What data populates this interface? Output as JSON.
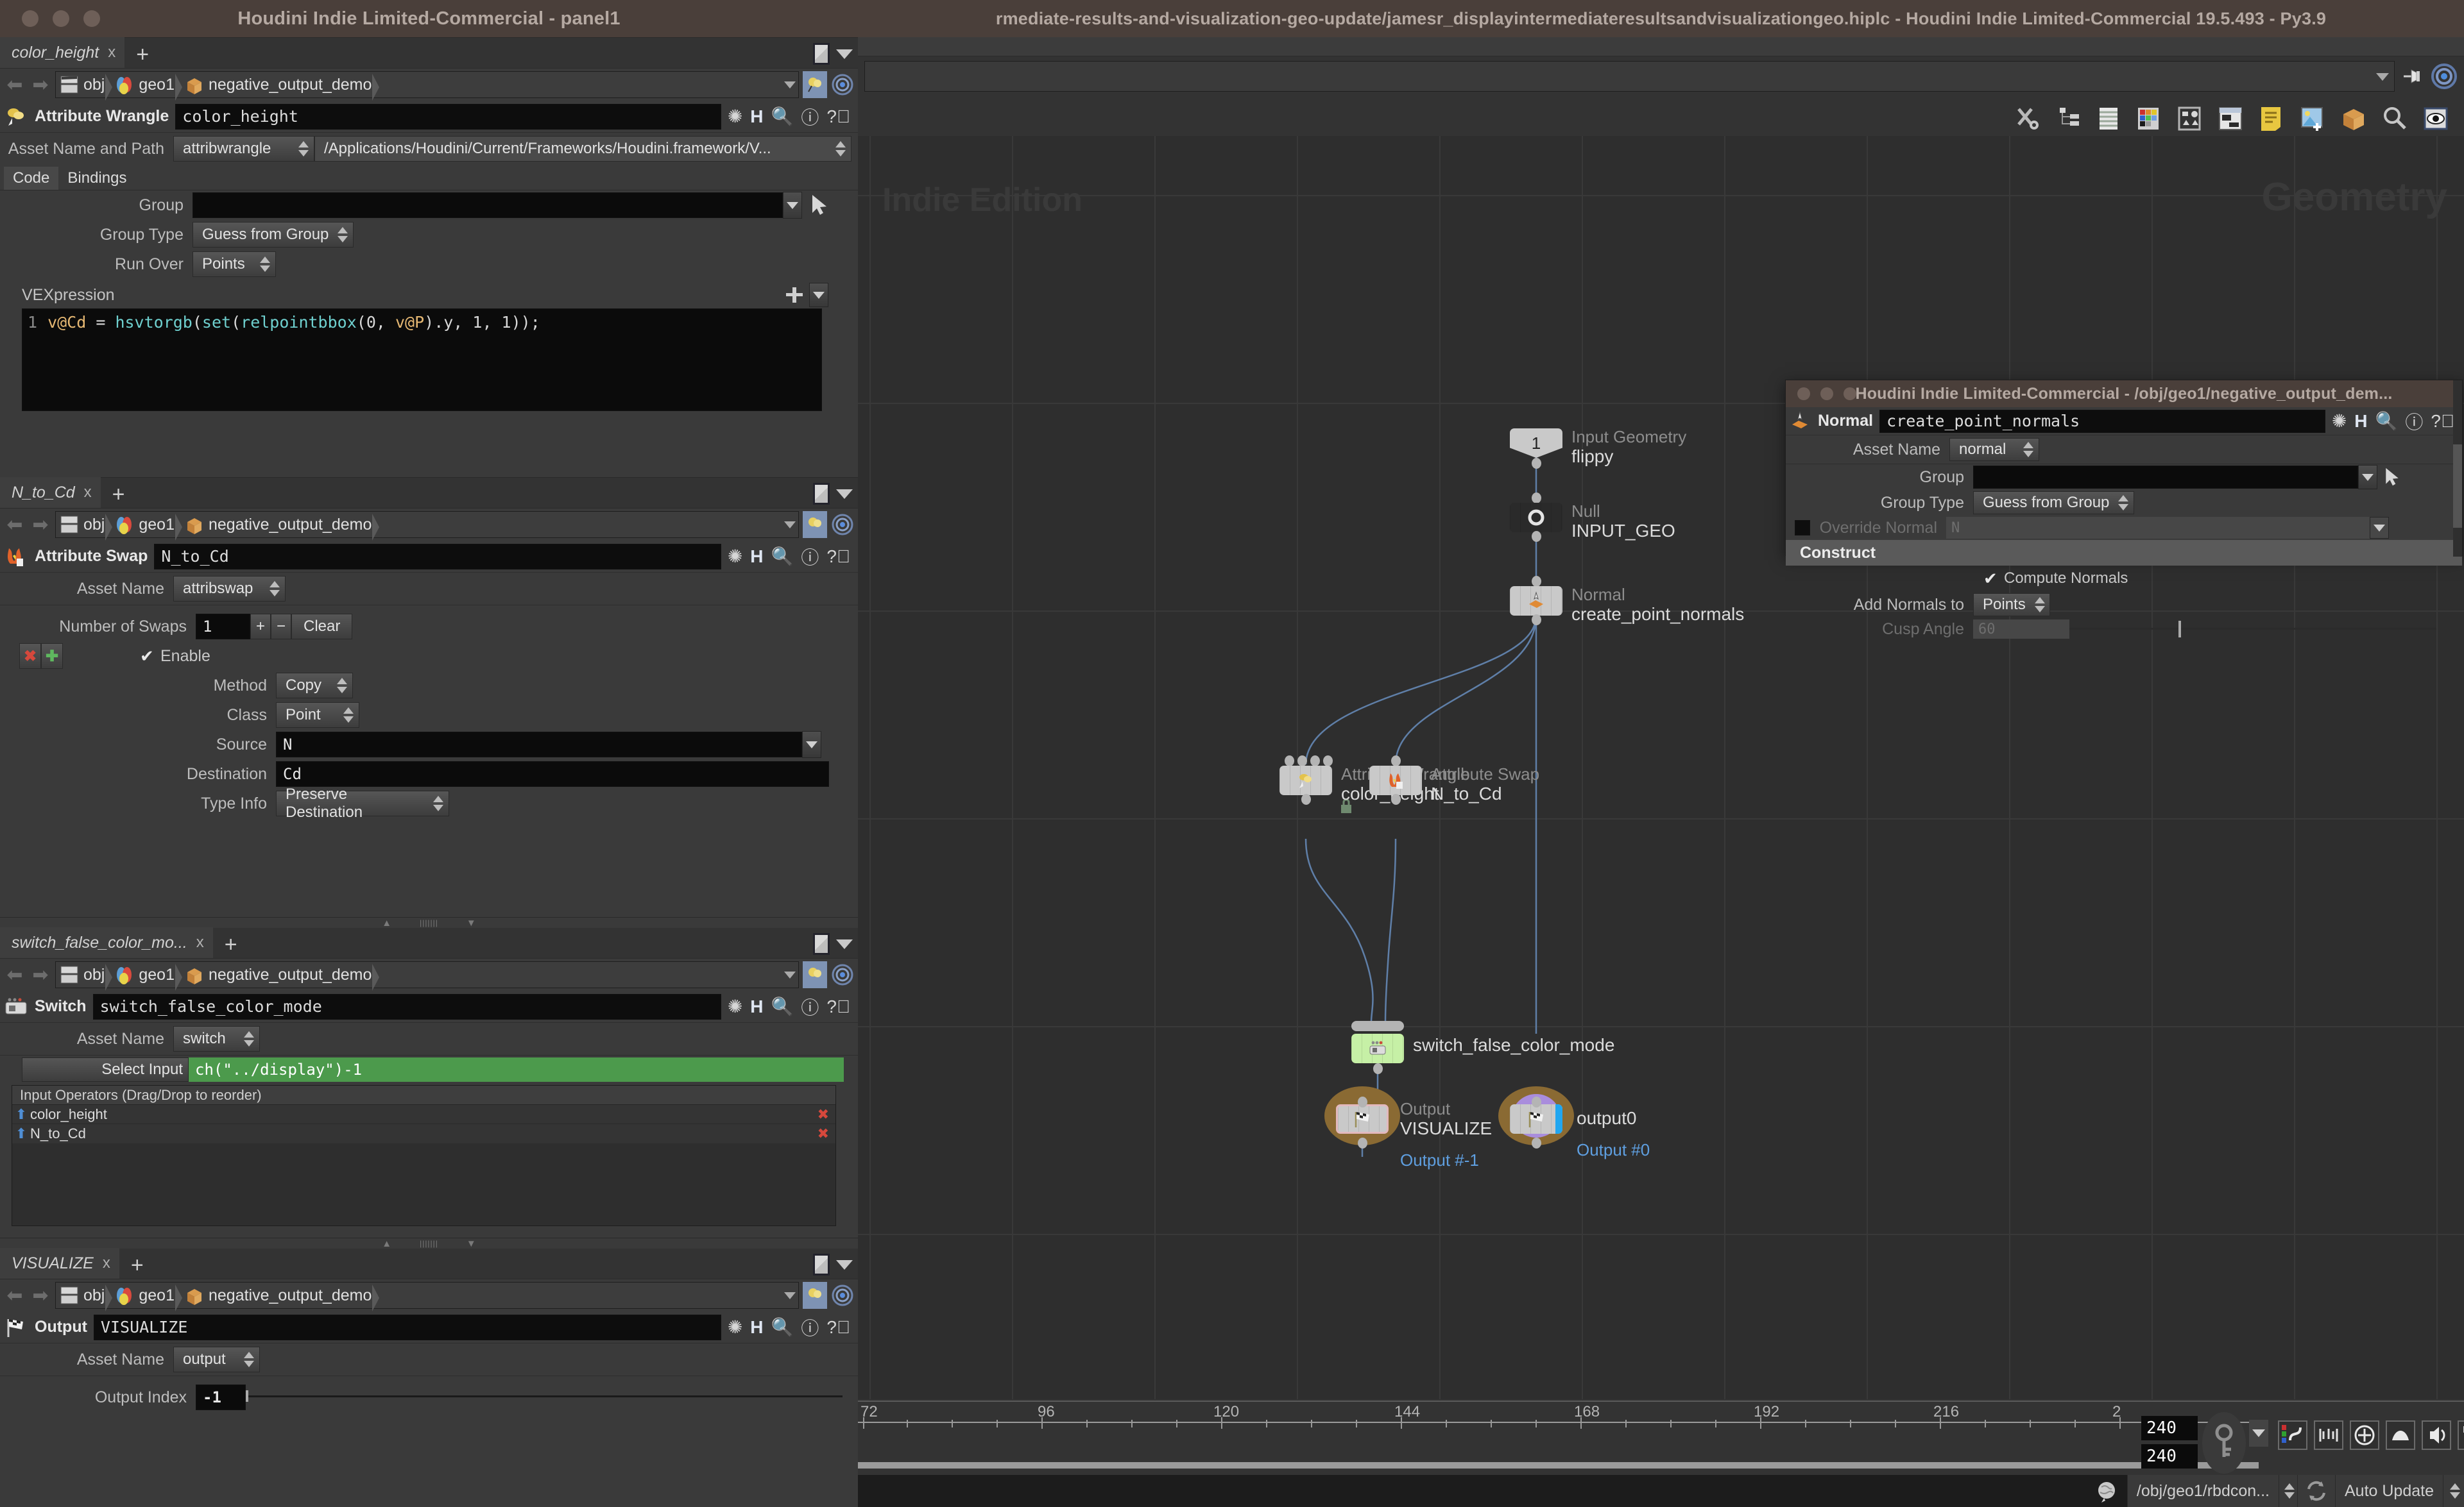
{
  "app": {
    "panel_window_title": "Houdini Indie Limited-Commercial - panel1",
    "main_window_title": "rmediate-results-and-visualization-geo-update/jamesr_displayintermediateresultsandvisualizationgeo.hiplc - Houdini Indie Limited-Commercial 19.5.493 - Py3.9",
    "float_window_title": "Houdini Indie Limited-Commercial - /obj/geo1/negative_output_dem..."
  },
  "breadcrumb": {
    "items": [
      "obj",
      "geo1",
      "negative_output_demo"
    ]
  },
  "panels": [
    {
      "tab_label": "color_height",
      "node_type": "Attribute Wrangle",
      "node_name": "color_height",
      "asset_label": "Asset Name and Path",
      "asset_name": "attribwrangle",
      "asset_path": "/Applications/Houdini/Current/Frameworks/Houdini.framework/V...",
      "subtabs": [
        "Code",
        "Bindings"
      ],
      "subtab_active": "Code",
      "fields": {
        "group_label": "Group",
        "group_value": "",
        "group_type_label": "Group Type",
        "group_type_value": "Guess from Group",
        "run_over_label": "Run Over",
        "run_over_value": "Points",
        "vexpression_label": "VEXpression",
        "code_line_number": "1",
        "code_tokens": [
          {
            "t": "v@Cd",
            "c": "var"
          },
          {
            "t": " = ",
            "c": "op"
          },
          {
            "t": "hsvtorgb",
            "c": "fn"
          },
          {
            "t": "(",
            "c": "op"
          },
          {
            "t": "set",
            "c": "fn"
          },
          {
            "t": "(",
            "c": "op"
          },
          {
            "t": "relpointbbox",
            "c": "fn"
          },
          {
            "t": "(0, ",
            "c": "op"
          },
          {
            "t": "v@P",
            "c": "var"
          },
          {
            "t": ").y, 1, 1));",
            "c": "op"
          }
        ]
      }
    },
    {
      "tab_label": "N_to_Cd",
      "node_type": "Attribute Swap",
      "node_name": "N_to_Cd",
      "asset_label": "Asset Name",
      "asset_name": "attribswap",
      "fields": {
        "num_swaps_label": "Number of Swaps",
        "num_swaps_value": "1",
        "clear_label": "Clear",
        "enable_label": "Enable",
        "enable_checked": true,
        "method_label": "Method",
        "method_value": "Copy",
        "class_label": "Class",
        "class_value": "Point",
        "source_label": "Source",
        "source_value": "N",
        "destination_label": "Destination",
        "destination_value": "Cd",
        "type_info_label": "Type Info",
        "type_info_value": "Preserve Destination"
      }
    },
    {
      "tab_label": "switch_false_color_mo...",
      "node_type": "Switch",
      "node_name": "switch_false_color_mode",
      "asset_label": "Asset Name",
      "asset_name": "switch",
      "fields": {
        "select_input_label": "Select Input",
        "select_input_value": "ch(\"../display\")-1",
        "select_input_color": "#4c9a4c",
        "list_header": "Input Operators (Drag/Drop to reorder)",
        "list_items": [
          "color_height",
          "N_to_Cd"
        ]
      }
    },
    {
      "tab_label": "VISUALIZE",
      "node_type": "Output",
      "node_name": "VISUALIZE",
      "asset_label": "Asset Name",
      "asset_name": "output",
      "fields": {
        "output_index_label": "Output Index",
        "output_index_value": "-1"
      }
    }
  ],
  "network": {
    "watermark_left": "Indie Edition",
    "watermark_right": "Geometry",
    "nodes": [
      {
        "type": "Input Geometry",
        "name": "flippy",
        "badge": "1"
      },
      {
        "type": "Null",
        "name": "INPUT_GEO"
      },
      {
        "type": "Normal",
        "name": "create_point_normals"
      },
      {
        "type": "Attribute Wrangle",
        "name": "color_height"
      },
      {
        "type": "Attribute Swap",
        "name": "N_to_Cd"
      },
      {
        "type": "",
        "name": "switch_false_color_mode"
      },
      {
        "type": "Output",
        "name": "VISUALIZE",
        "flag": "Output #-1"
      },
      {
        "type": "",
        "name": "output0",
        "flag": "Output #0"
      }
    ]
  },
  "float_panel": {
    "node_type": "Normal",
    "node_name": "create_point_normals",
    "asset_label": "Asset Name",
    "asset_name": "normal",
    "group_label": "Group",
    "group_value": "",
    "group_type_label": "Group Type",
    "group_type_value": "Guess from Group",
    "override_normal_label": "Override Normal",
    "override_normal_value": "N",
    "construct_label": "Construct",
    "compute_normals_label": "Compute Normals",
    "compute_normals_checked": true,
    "add_normals_label": "Add Normals to",
    "add_normals_value": "Points",
    "cusp_angle_label": "Cusp Angle",
    "cusp_angle_value": "60"
  },
  "timeline": {
    "tick_labels": [
      "72",
      "96",
      "120",
      "144",
      "168",
      "192",
      "216",
      "2"
    ],
    "current_frame": "240",
    "end_frame": "240"
  },
  "statusbar": {
    "path": "/obj/geo1/rbdcon...",
    "update_mode": "Auto Update"
  }
}
